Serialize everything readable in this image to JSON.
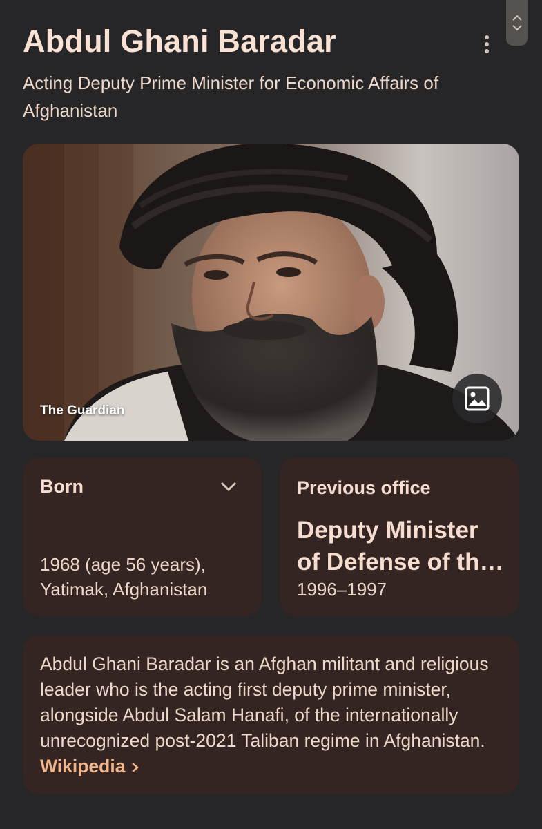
{
  "header": {
    "title": "Abdul Ghani Baradar",
    "subtitle": "Acting Deputy Prime Minister for Economic Affairs of Afghanistan",
    "menu_icon": "more-vert-icon"
  },
  "scroll_control": {
    "icons": [
      "chevron-up-icon",
      "chevron-down-icon"
    ]
  },
  "photo": {
    "caption": "The Guardian",
    "view_images_icon": "image-icon"
  },
  "born_card": {
    "label": "Born",
    "value_line1": "1968 (age 56 years),",
    "value_line2": "Yatimak, Afghanistan",
    "expand_icon": "chevron-down-icon"
  },
  "office_card": {
    "label": "Previous office",
    "title_line1": "Deputy Minister",
    "title_line2": "of Defense of th…",
    "years": "1996–1997"
  },
  "description": {
    "text": "Abdul Ghani Baradar is an Afghan militant and religious leader who is the acting first deputy prime minister, alongside Abdul Salam Hanafi, of the internationally unrecognized post-2021 Taliban regime in Afghanistan.",
    "link_label": "Wikipedia",
    "link_icon": "chevron-right-icon"
  },
  "colors": {
    "background": "#262527",
    "card": "#342523",
    "title_text": "#f9e1d3",
    "link": "#f0b58a"
  }
}
